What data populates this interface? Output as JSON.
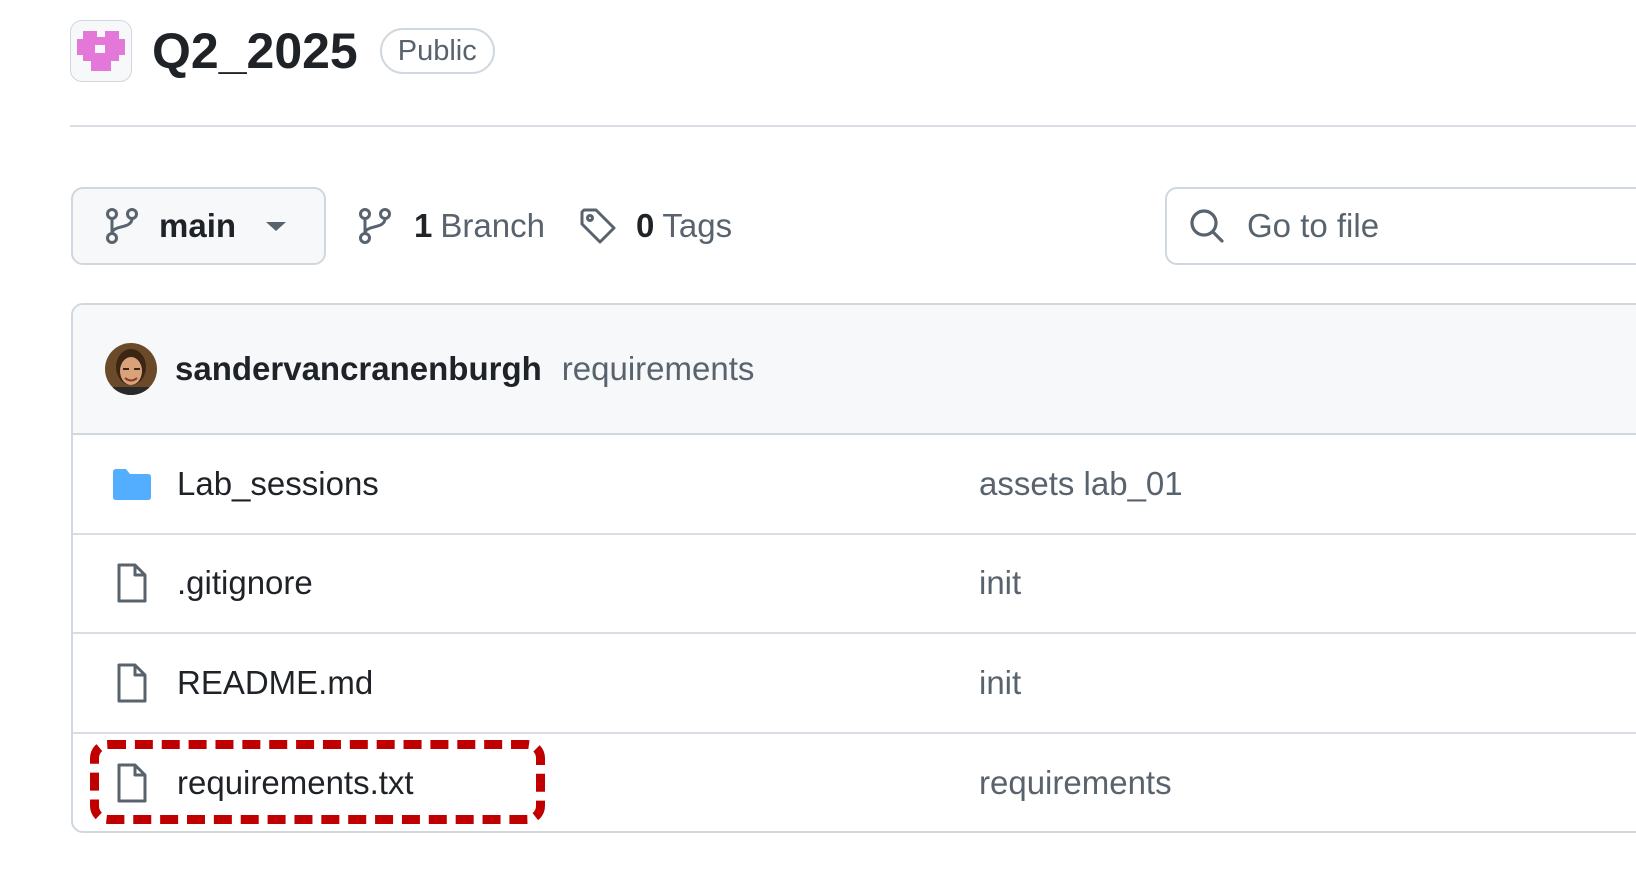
{
  "repo": {
    "name": "Q2_2025",
    "visibility": "Public",
    "avatar_icon": "pixel-heart-icon",
    "accent_color": "#e478d8"
  },
  "toolbar": {
    "branch": "main",
    "branch_count": "1",
    "branch_label": "Branch",
    "tag_count": "0",
    "tag_label": "Tags",
    "search_placeholder": "Go to file"
  },
  "latest_commit": {
    "author": "sandervancranenburgh",
    "message": "requirements"
  },
  "files": [
    {
      "type": "folder",
      "name": "Lab_sessions",
      "message": "assets lab_01"
    },
    {
      "type": "file",
      "name": ".gitignore",
      "message": "init"
    },
    {
      "type": "file",
      "name": "README.md",
      "message": "init"
    },
    {
      "type": "file",
      "name": "requirements.txt",
      "message": "requirements"
    }
  ],
  "colors": {
    "highlight": "#c00000",
    "folder": "#54aeff"
  }
}
